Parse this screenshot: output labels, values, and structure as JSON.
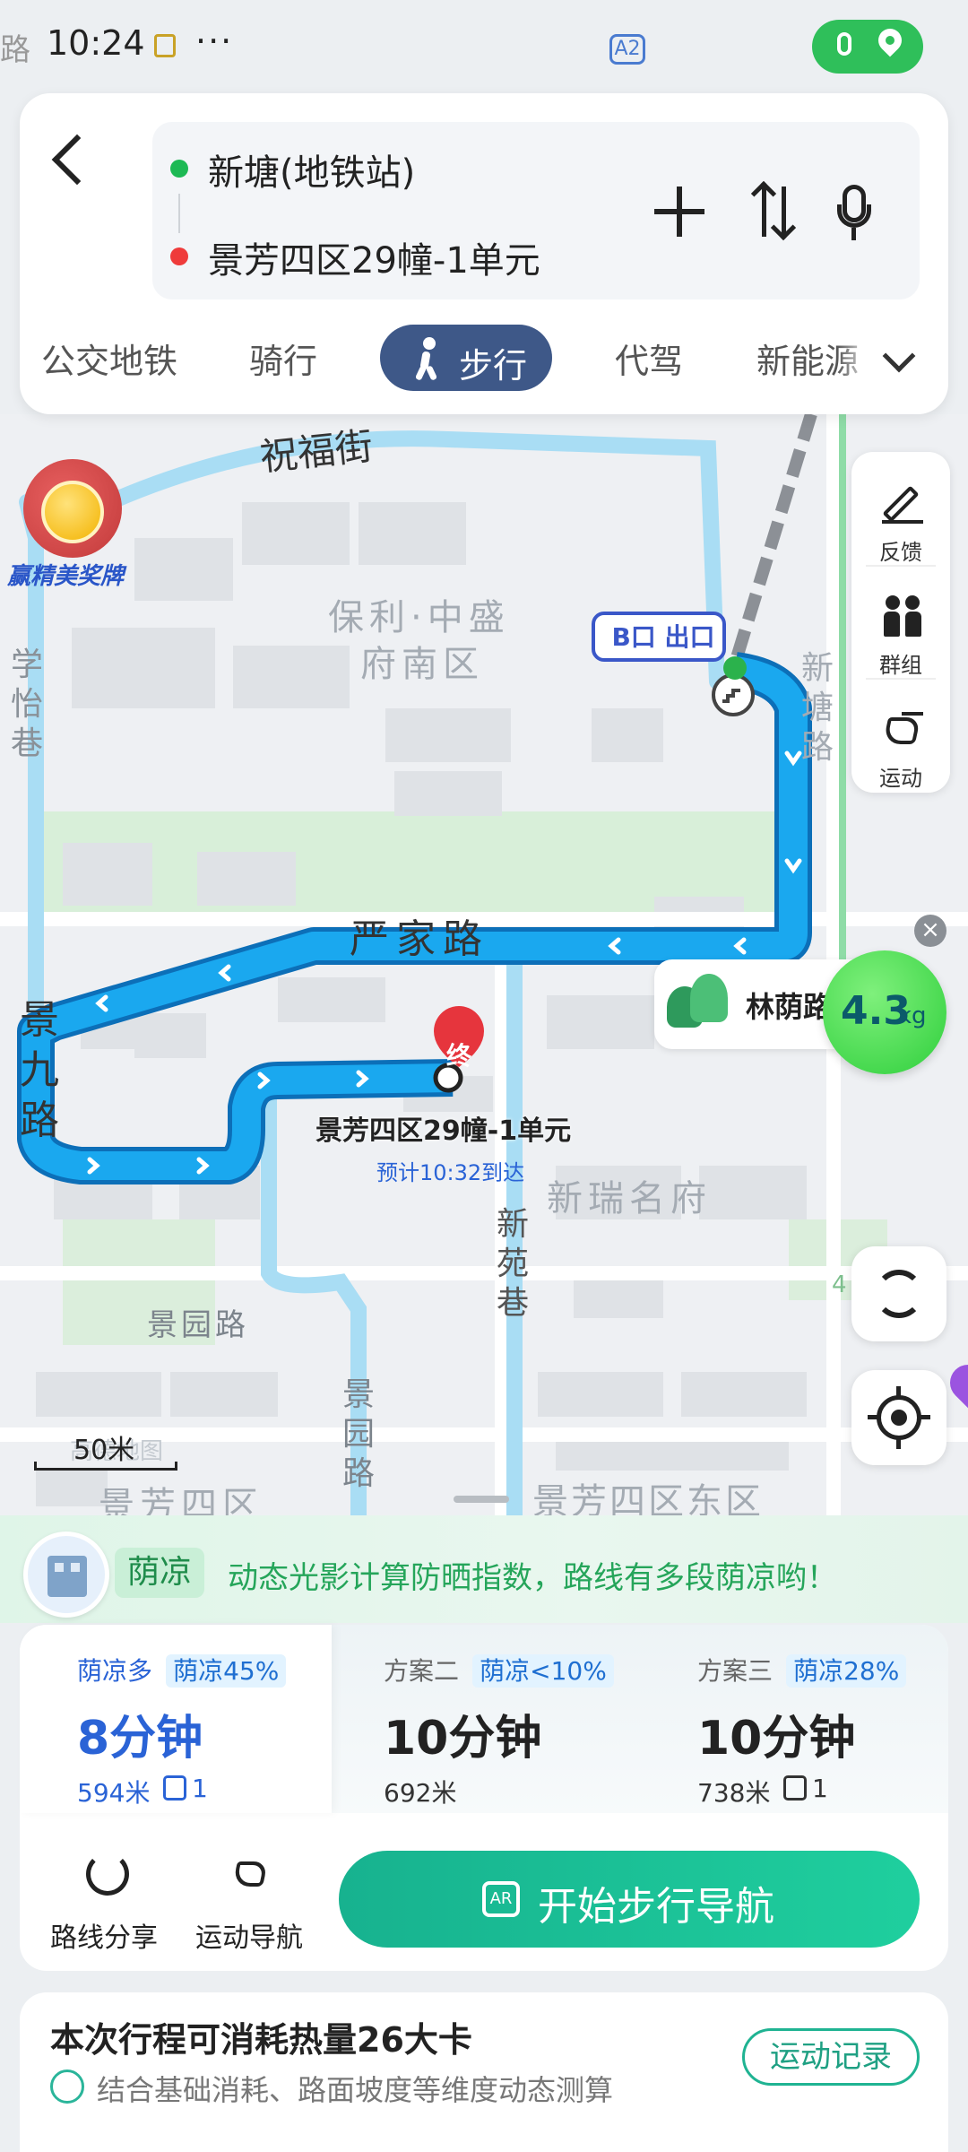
{
  "status_bar": {
    "time": "10:24",
    "dots": "···",
    "left_edge_text": "路",
    "road_badge": "A2"
  },
  "route": {
    "from": "新塘(地铁站)",
    "to": "景芳四区29幢-1单元"
  },
  "tabs": [
    {
      "label": "公交地铁"
    },
    {
      "label": "骑行"
    },
    {
      "label": "步行",
      "active": true
    },
    {
      "label": "代驾"
    },
    {
      "label": "新能源"
    }
  ],
  "map": {
    "promo_label": "赢精美奖牌",
    "exit_label": "B口 出口",
    "area_labels": {
      "baoli_1": "保利·中盛",
      "baoli_2": "府南区",
      "xinrui": "新瑞名府",
      "jingfang4": "景芳四区",
      "jingfang4_east": "景芳四区东区",
      "watermark": "高德地图"
    },
    "roads": {
      "zhufu": "祝福街",
      "xueyi": "学怡巷",
      "xintang": "新塘路",
      "yanjia": "严家路",
      "jingjiu": "景九路",
      "jingyuan_h": "景园路",
      "jingyuan_v": "景园路",
      "xinyuan": "新苑巷"
    },
    "destination": {
      "marker": "终",
      "name": "景芳四区29幢-1单元",
      "eta": "预计10:32到达"
    },
    "shade_poi": {
      "label": "林荫路",
      "carbon_value": "4.3",
      "carbon_unit": "kg"
    },
    "scale": "50米",
    "edge_number": "4"
  },
  "tools": [
    {
      "label": "反馈",
      "icon": "pencil-icon"
    },
    {
      "label": "群组",
      "icon": "group-icon"
    },
    {
      "label": "运动",
      "icon": "sport-shoe-icon"
    }
  ],
  "shade_banner": {
    "badge": "荫凉",
    "text": "动态光影计算防晒指数，路线有多段荫凉哟！"
  },
  "plans": [
    {
      "name": "荫凉多",
      "tag": "荫凉45%",
      "time": "8分钟",
      "distance": "594米",
      "crossings": "1"
    },
    {
      "name": "方案二",
      "tag": "荫凉<10%",
      "time": "10分钟",
      "distance": "692米",
      "crossings": ""
    },
    {
      "name": "方案三",
      "tag": "荫凉28%",
      "time": "10分钟",
      "distance": "738米",
      "crossings": "1"
    }
  ],
  "actions": {
    "share": "路线分享",
    "sport_nav": "运动导航",
    "start": "开始步行导航",
    "ar": "AR"
  },
  "calories": {
    "title": "本次行程可消耗热量26大卡",
    "subtitle": "结合基础消耗、路面坡度等维度动态测算",
    "button": "运动记录"
  },
  "colors": {
    "route": "#1aa8ef",
    "accent_green": "#1fbf96",
    "active_tab": "#3e5888",
    "carbon_green": "#3ad64a"
  }
}
